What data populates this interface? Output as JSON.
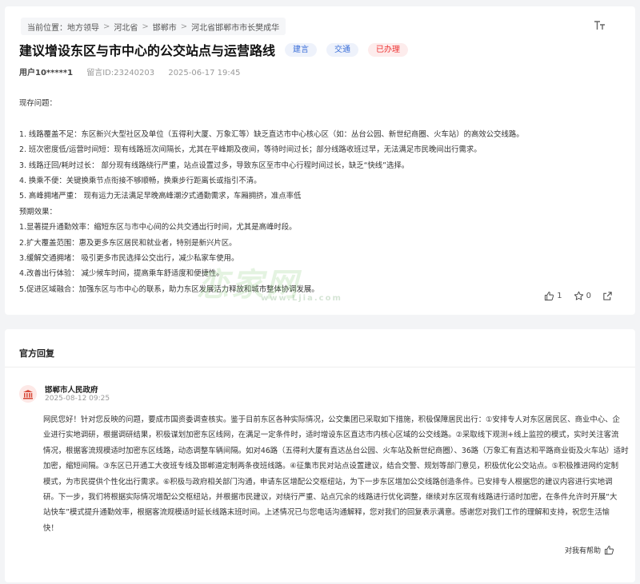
{
  "breadcrumb": {
    "label": "当前位置：",
    "items": [
      "地方领导",
      "河北省",
      "邯郸市",
      "河北省邯郸市市长樊成华"
    ]
  },
  "font_toggle_icon": "text-size-icon",
  "post": {
    "title": "建议增设东区与市中心的公交站点与运营路线",
    "tags": [
      "建言",
      "交通",
      "已办理"
    ],
    "user": "用户10*****1",
    "message_id": "留言ID:23240203",
    "datetime": "2025-06-17 19:45",
    "lines_a": [
      "现存问题："
    ],
    "lines_b": [
      "1.  线路覆盖不足：东区新兴大型社区及单位（五得利大厦、万象汇等）缺乏直达市中心核心区（如：丛台公园、新世纪商圈、火车站）的高效公交线路。",
      "2.  班次密度低/运营时间短：现有线路班次间隔长，尤其在平峰期及夜间，等待时间过长；部分线路收班过早，无法满足市民晚间出行需求。",
      "3.  线路迂回/耗时过长：  部分现有线路绕行严重，站点设置过多，导致东区至市中心行程时间过长，缺乏“快线”选择。",
      "4.  换乘不便：关键换乘节点衔接不够顺畅，换乘步行距离长或指引不清。",
      "5.  高峰拥堵严重：  现有运力无法满足早晚高峰潮汐式通勤需求，车厢拥挤，准点率低",
      "预期效果：",
      "1.显著提升通勤效率：缩短东区与市中心间的公共交通出行时间，尤其是高峰时段。",
      "2.扩大覆盖范围：惠及更多东区居民和就业者，特别是新兴片区。",
      "3.缓解交通拥堵：  吸引更多市民选择公交出行，减少私家车使用。",
      "4.改善出行体验：  减少候车时间，提高乘车舒适度和便捷性。",
      "5.促进区域融合：加强东区与市中心的联系，助力东区发展活力释放和城市整体协调发展。"
    ],
    "like_count": "1",
    "star_count": "0",
    "watermark": "恋家网",
    "watermark_sub": "www.Ljia.com"
  },
  "official": {
    "section_title": "官方回复",
    "org_name": "邯郸市人民政府",
    "date": "2025-08-12 09:25",
    "reply_lines": [
      "网民您好！针对您反映的问题，要成市国资委调查核实。鉴于目前东区各种实际情况，公交集团已采取如下措施，积极保障居民出行：①安排专人对东区居民区、商业中心、企",
      "业进行实地调研，根据调研结果，积极谋划加密东区线网，在满足一定条件时，适时增设东区直达市内核心区域的公交线路。②采取线下观测+线上监控的模式，实时关注客流",
      "情况，根据客流规模适时加密东区线路，动态调整车辆间隔。如对46路（五得利大厦有直达丛台公园、火车站及新世纪商圈）、36路（万象汇有直达和平路商业街及火车站）适时",
      "加密，缩短间隔。③东区已开通工大夜班专线及邯郸道定制两条夜班线路。④征集市民对站点设置建议，结合交警、规划等部门意见，积极优化公交站点。⑤积极推进网约定制",
      "模式，为市民提供个性化出行需求。⑥积极与政府相关部门沟通，申请东区增配公交枢纽站，为下一步东区增加公交线路创造条件。已安排专人根据您的建议内容进行实地调",
      "研。下一步，我们将根据实际情况增配公交枢纽站，并根据市民建议，对绕行严重、站点冗余的线路进行优化调整，继续对东区现有线路进行适时加密，在条件允许时开展“大",
      "站快车”模式提升通勤效率，根据客流规模适时延长线路末班时间。上述情况已与您电话沟通解释，您对我们的回复表示满意。感谢您对我们工作的理解和支持，祝您生活愉",
      "快！"
    ],
    "helpful_label": "对我有帮助"
  },
  "colors": {
    "tag_blue": "#3b6fd8",
    "tag_red": "#e33333",
    "gov_icon": "#d84a3a"
  }
}
